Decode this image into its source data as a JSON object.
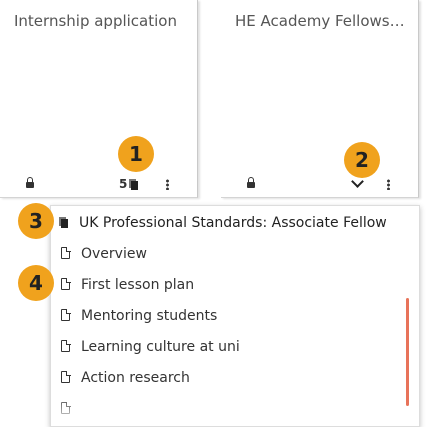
{
  "cards": [
    {
      "title": "Internship application",
      "pages_count": "5"
    },
    {
      "title": "HE Academy Fellowsh..."
    }
  ],
  "badges": [
    "1",
    "2",
    "3",
    "4"
  ],
  "dropdown": {
    "heading": "UK Professional Standards: Associate Fellow",
    "items": [
      "Overview",
      "First lesson plan",
      "Mentoring students",
      "Learning culture at uni",
      "Action research"
    ]
  },
  "icons": {
    "lock": "lock-icon",
    "pages": "pages-icon",
    "more": "kebab-icon",
    "expand": "chevron-down-icon",
    "page": "page-icon"
  },
  "colors": {
    "badge": "#f0a21d",
    "scrollbar": "#e8735a"
  }
}
